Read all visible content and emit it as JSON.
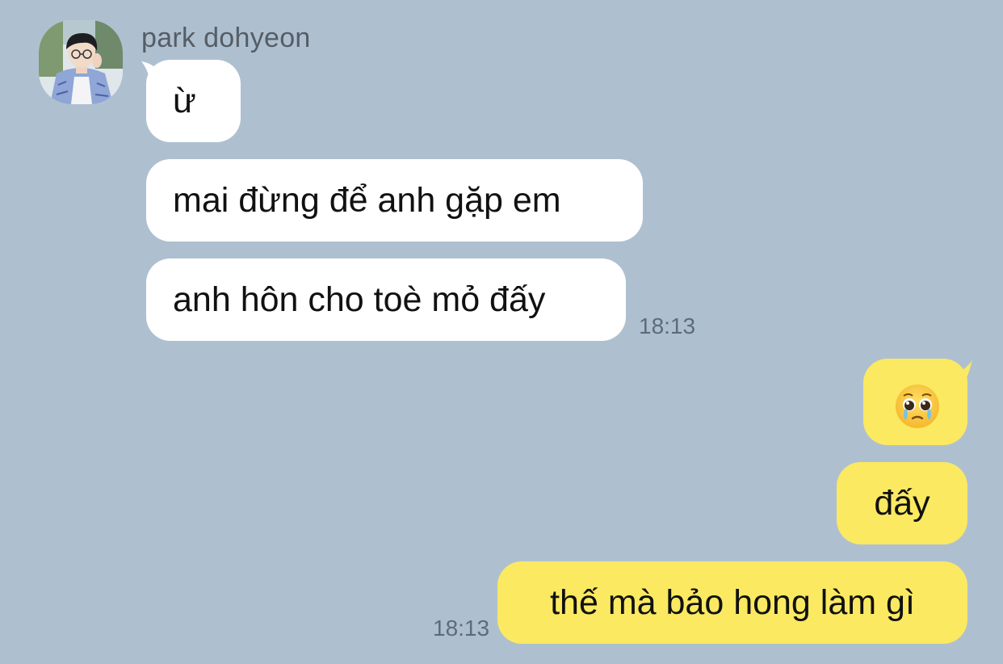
{
  "sender": {
    "name": "park dohyeon"
  },
  "incoming": [
    {
      "text": "ừ"
    },
    {
      "text": "mai đừng để anh gặp em"
    },
    {
      "text": "anh hôn cho toè mỏ đấy"
    }
  ],
  "incoming_time": "18:13",
  "outgoing": [
    {
      "emoji": "pleading-face-with-tears-emoji"
    },
    {
      "text": "đấy"
    },
    {
      "text": "thế mà bảo hong làm gì"
    }
  ],
  "outgoing_time": "18:13",
  "colors": {
    "background": "#aec0d0",
    "incoming_bubble": "#ffffff",
    "outgoing_bubble": "#fbe961",
    "timestamp": "#5f6b77",
    "sender_name": "#555d66"
  }
}
